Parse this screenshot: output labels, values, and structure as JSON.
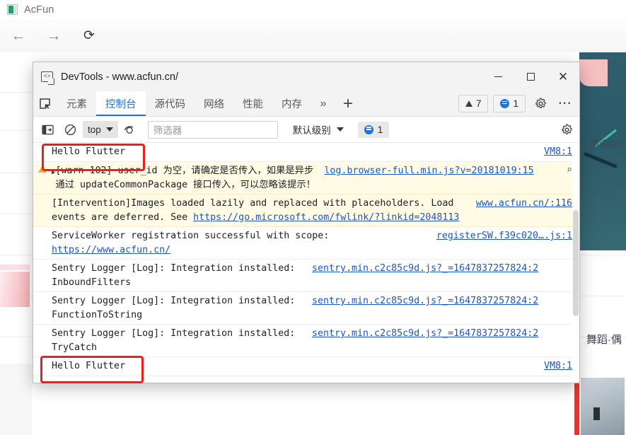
{
  "browser": {
    "tab_title": "AcFun",
    "favicon": "acfun-favicon-icon",
    "nav": {
      "back": "←",
      "forward": "→",
      "reload": "⟳"
    }
  },
  "page": {
    "hero_label": "幽魂端游",
    "section_title": "舞蹈·偶"
  },
  "devtools": {
    "window_title": "DevTools - www.acfun.cn/",
    "window_controls": {
      "minimize": "minimize-icon",
      "maximize": "maximize-icon",
      "close": "✕"
    },
    "tabs": [
      {
        "label": "元素",
        "active": false
      },
      {
        "label": "控制台",
        "active": true
      },
      {
        "label": "源代码",
        "active": false
      },
      {
        "label": "网络",
        "active": false
      },
      {
        "label": "性能",
        "active": false
      },
      {
        "label": "内存",
        "active": false
      }
    ],
    "more_tabs": "»",
    "add_tab": "+",
    "warning_count": "7",
    "issue_count": "1",
    "settings_icon": "gear-icon",
    "more_options": "⋯",
    "console_toolbar": {
      "sidebar_toggle": "sidebar-toggle-icon",
      "clear_console": "clear-console-icon",
      "context_value": "top",
      "eye_icon": "live-expression-icon",
      "filter_placeholder": "筛选器",
      "filter_value": "",
      "level_value": "默认级别",
      "issue_badge_count": "1",
      "settings": "gear-icon"
    }
  },
  "console_messages": [
    {
      "kind": "log",
      "text": "Hello Flutter",
      "link": "VM8:1",
      "highlighted": true
    },
    {
      "kind": "warn",
      "text": "[warn 102] user_id 为空，请确定是否传入，如果是异步通过 updateCommonPackage 接口传入，可以忽略该提示！",
      "link": "log.browser-full.min.js?v=20181019:15",
      "has_disclosure": true,
      "has_search": true
    },
    {
      "kind": "violation",
      "text": "[Intervention]Images loaded lazily and replaced with placeholders. Load events are deferred. See ",
      "inline_link": "https://go.microsoft.com/fwlink/?linkid=2048113",
      "link": "www.acfun.cn/:116"
    },
    {
      "kind": "log",
      "text": "ServiceWorker registration successful with scope: ",
      "inline_link": "https://www.acfun.cn/",
      "link": "registerSW.f39c020….js:1"
    },
    {
      "kind": "log",
      "text": "Sentry Logger [Log]: Integration installed: InboundFilters",
      "link": "sentry.min.c2c85c9d.js?_=1647837257824:2"
    },
    {
      "kind": "log",
      "text": "Sentry Logger [Log]: Integration installed: FunctionToString",
      "link": "sentry.min.c2c85c9d.js?_=1647837257824:2"
    },
    {
      "kind": "log",
      "text": "Sentry Logger [Log]: Integration installed: TryCatch",
      "link": "sentry.min.c2c85c9d.js?_=1647837257824:2"
    },
    {
      "kind": "log",
      "text": "Hello Flutter",
      "link": "VM8:1",
      "highlighted": true
    }
  ],
  "annotations": {
    "color": "#f01d1d",
    "boxes": [
      {
        "name": "annotation-box-hello-flutter-top"
      },
      {
        "name": "annotation-box-hello-flutter-bottom"
      }
    ]
  }
}
